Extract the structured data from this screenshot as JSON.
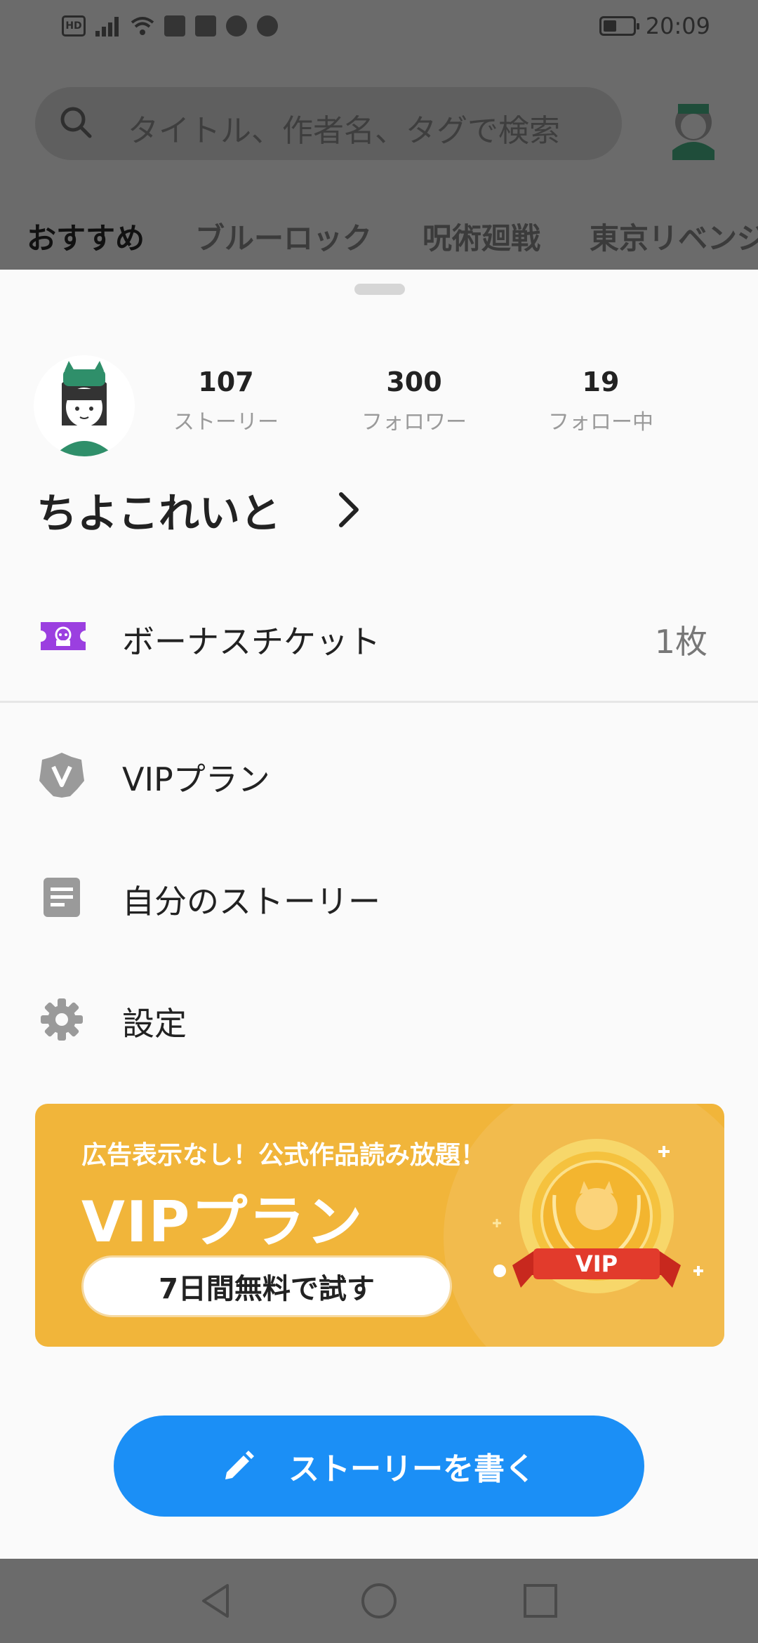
{
  "status_bar": {
    "time": "20:09",
    "left_icons": [
      "hd-icon",
      "signal-icon",
      "wifi-icon",
      "yahoo-icon",
      "gmail-icon",
      "line-icon",
      "chat-icon"
    ],
    "hd_label": "HD"
  },
  "search": {
    "placeholder": "タイトル、作者名、タグで検索"
  },
  "tabs": [
    {
      "label": "おすすめ",
      "active": true
    },
    {
      "label": "ブルーロック",
      "active": false
    },
    {
      "label": "呪術廻戦",
      "active": false
    },
    {
      "label": "東京リベンジ",
      "active": false
    }
  ],
  "profile": {
    "username": "ちよこれいと",
    "stats": [
      {
        "value": "107",
        "label": "ストーリー"
      },
      {
        "value": "300",
        "label": "フォロワー"
      },
      {
        "value": "19",
        "label": "フォロー中"
      }
    ]
  },
  "ticket": {
    "label": "ボーナスチケット",
    "count": "1枚",
    "icon": "ticket-icon"
  },
  "menu": [
    {
      "label": "VIPプラン",
      "icon": "vip-badge-icon"
    },
    {
      "label": "自分のストーリー",
      "icon": "document-icon"
    },
    {
      "label": "設定",
      "icon": "gear-icon"
    }
  ],
  "vip_banner": {
    "tagline": "広告表示なし！公式作品読み放題！",
    "title": "VIPプラン",
    "button": "7日間無料で試す",
    "medal_text": "VIP"
  },
  "write_button": {
    "label": "ストーリーを書く",
    "icon": "pencil-icon"
  },
  "colors": {
    "accent_blue": "#1b8ff6",
    "vip_gold": "#f1b53a",
    "ticket_purple": "#9b3fe0"
  }
}
